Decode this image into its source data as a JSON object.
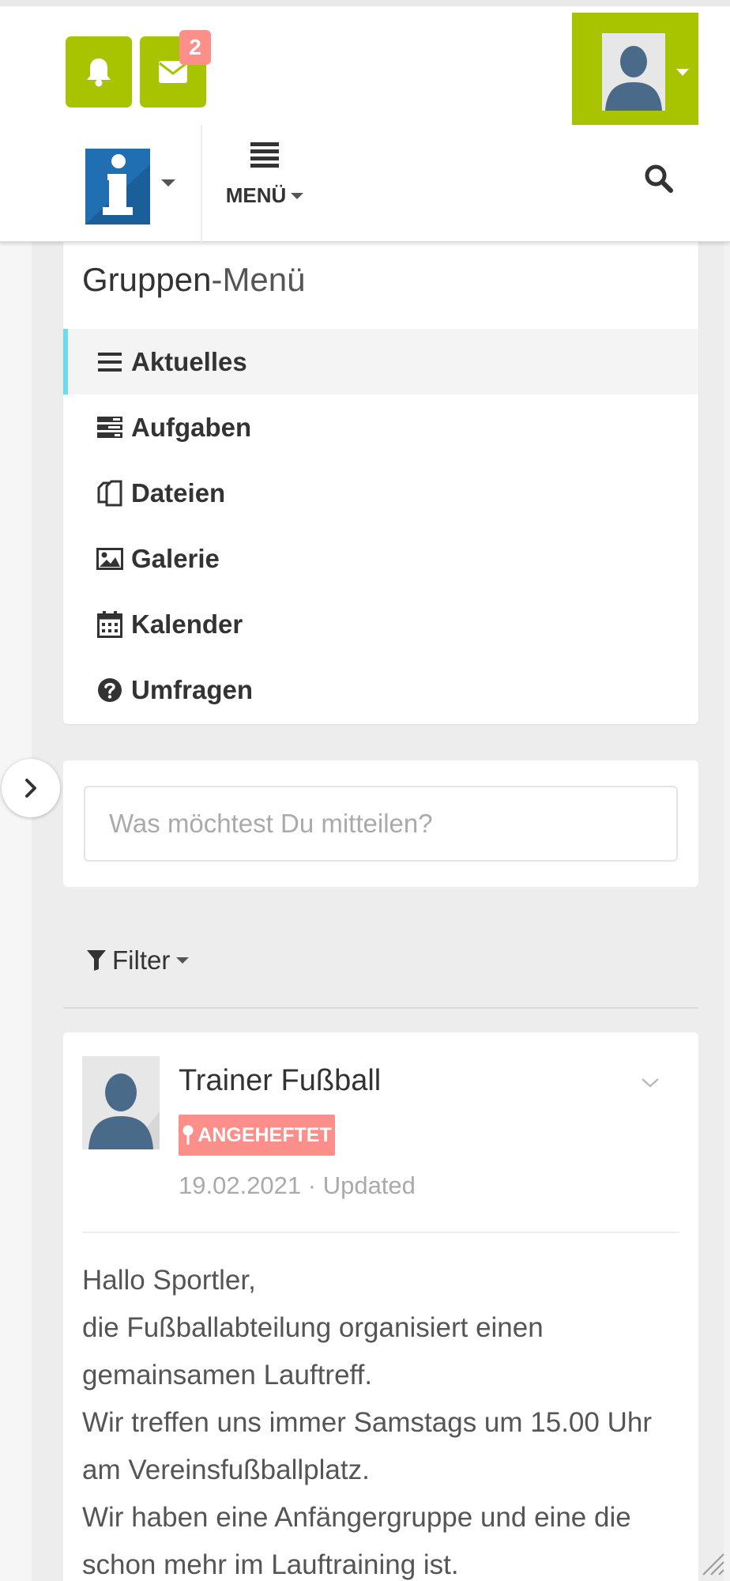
{
  "header": {
    "mail_badge_count": "2",
    "menu_label": "MENÜ"
  },
  "group_menu": {
    "title_bold": "Gruppen",
    "title_light": "-Menü",
    "items": [
      {
        "label": "Aktuelles",
        "icon": "list-icon",
        "active": true
      },
      {
        "label": "Aufgaben",
        "icon": "tasks-icon",
        "active": false
      },
      {
        "label": "Dateien",
        "icon": "files-icon",
        "active": false
      },
      {
        "label": "Galerie",
        "icon": "image-icon",
        "active": false
      },
      {
        "label": "Kalender",
        "icon": "calendar-icon",
        "active": false
      },
      {
        "label": "Umfragen",
        "icon": "question-circle-icon",
        "active": false
      }
    ]
  },
  "share": {
    "placeholder": "Was möchtest Du mitteilen?"
  },
  "filter": {
    "label": "Filter"
  },
  "post": {
    "author": "Trainer Fußball",
    "pin_label": "ANGEHEFTET",
    "meta": "19.02.2021 · Updated",
    "body": [
      "Hallo Sportler,",
      "die Fußballabteilung organisiert einen gemainsamen Lauftreff.",
      "Wir treffen uns immer Samstags um 15.00 Uhr am Vereinsfußballplatz.",
      "Wir haben eine Anfängergruppe und eine die schon mehr im Lauftraining ist."
    ]
  },
  "colors": {
    "accent_green": "#a8c400",
    "badge_red": "#fc8f8a",
    "active_blue": "#6fdbe8",
    "logo_blue": "#1f6fb2"
  }
}
